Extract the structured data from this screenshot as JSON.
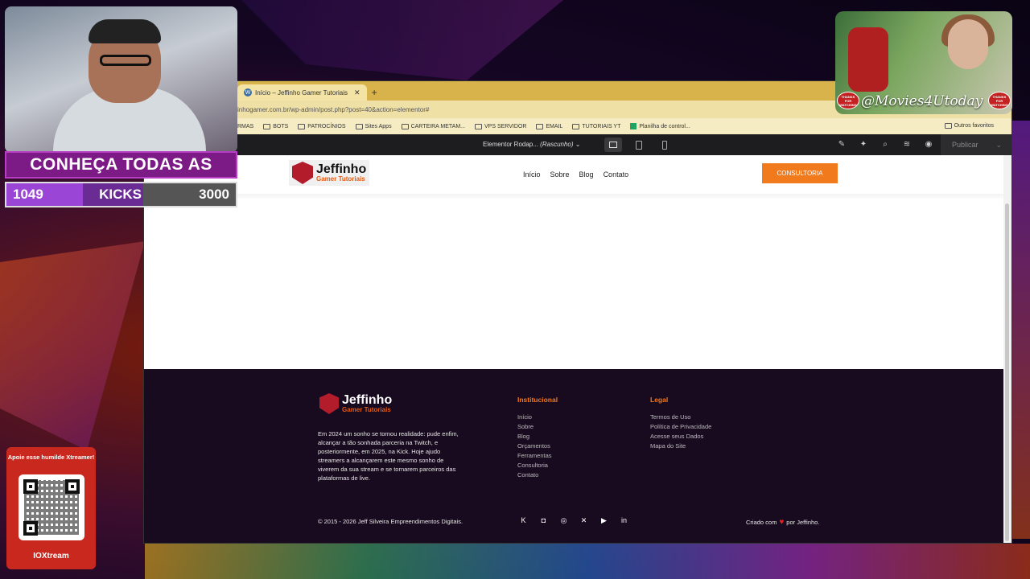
{
  "browser": {
    "tab_label": "Início – Jeffinho Gamer Tutoriais",
    "url": "inhogamer.com.br/wp-admin/post.php?post=40&action=elementor#",
    "bookmarks": [
      "RMAS",
      "BOTS",
      "PATROCÍNIOS",
      "Sites Apps",
      "CARTEIRA METAM...",
      "VPS SERVIDOR",
      "EMAIL",
      "TUTORIAIS YT",
      "Planilha de control..."
    ],
    "bookmarks_right": "Outros favoritos"
  },
  "elementor": {
    "doc_name": "Elementor Rodap...",
    "doc_status": "(Rascunho)",
    "publish_label": "Publicar"
  },
  "site": {
    "logo_title": "Jeffinho",
    "logo_sub": "Gamer Tutoriais",
    "nav": [
      "Início",
      "Sobre",
      "Blog",
      "Contato"
    ],
    "cta": "CONSULTORIA"
  },
  "footer": {
    "about": "Em 2024 um sonho se tornou realidade: pude enfim, alcançar a tão sonhada parceria na Twitch, e posteriormente, em 2025, na Kick. Hoje ajudo streamers a alcançarem este mesmo sonho de viverem da sua stream e se tornarem parceiros das plataformas de live.",
    "col1_title": "Institucional",
    "col1_links": [
      "Início",
      "Sobre",
      "Blog",
      "Orçamentos",
      "Ferramentas",
      "Consultoria",
      "Contato"
    ],
    "col2_title": "Legal",
    "col2_links": [
      "Termos de Uso",
      "Política de Privacidade",
      "Acesse seus Dados",
      "Mapa do Site"
    ],
    "copyright": "© 2015 - 2026 Jeff Silveira Empreendimentos Digitais.",
    "made_prefix": "Criado com",
    "made_suffix": "por Jeffinho."
  },
  "overlay": {
    "banner": "CONHEÇA TODAS AS",
    "count_current": "1049",
    "count_label": "KICKS",
    "count_goal": "3000",
    "movie_handle": "@Movies4Utoday",
    "thanks": "THANKS FOR WATCHING",
    "qr_caption": "Apoie esse humilde Xtreamer!",
    "qr_brand": "IOXtream"
  },
  "colors": {
    "accent": "#f07a1c",
    "footer_bg": "#180a1f",
    "tabbar": "#d8b24a"
  }
}
